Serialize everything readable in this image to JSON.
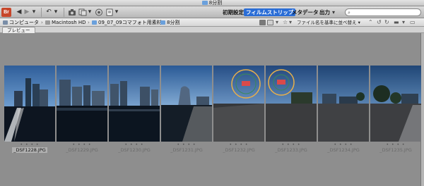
{
  "window": {
    "title": "8分割"
  },
  "toolbar": {
    "back_icon": "◀",
    "forward_icon": "▶",
    "dropdown_icon": "▾",
    "rotate_icon": "↶",
    "workspaces": [
      {
        "label": "初期設定",
        "active": false
      },
      {
        "label": "フィルムストリップ",
        "active": true
      },
      {
        "label": "メタデータ",
        "active": false
      },
      {
        "label": "出力",
        "active": false
      }
    ],
    "search": {
      "icon": "⌕",
      "value": "",
      "placeholder": ""
    }
  },
  "pathbar": {
    "crumbs": [
      {
        "label": "コンピュータ",
        "icon": "computer-icon"
      },
      {
        "label": "Macintosh HD",
        "icon": "drive-icon"
      },
      {
        "label": "09_07_09コマフォト用素材",
        "icon": "folder-icon"
      },
      {
        "label": "8分割",
        "icon": "folder-icon"
      }
    ],
    "separator": "›",
    "sort_label": "ファイル名を基準に並べ替え ▾"
  },
  "panel": {
    "tab_label": "プレビュー"
  },
  "filmstrip": {
    "rating_dots": "• • • •",
    "items": [
      {
        "filename": "_DSF1228.JPG",
        "selected": true
      },
      {
        "filename": "_DSF1229.JPG",
        "selected": false
      },
      {
        "filename": "_DSF1230.JPG",
        "selected": false
      },
      {
        "filename": "_DSF1231.JPG",
        "selected": false
      },
      {
        "filename": "_DSF1232.JPG",
        "selected": false
      },
      {
        "filename": "_DSF1233.JPG",
        "selected": false
      },
      {
        "filename": "_DSF1234.JPG",
        "selected": false
      },
      {
        "filename": "_DSF1235.JPG",
        "selected": false
      }
    ]
  }
}
